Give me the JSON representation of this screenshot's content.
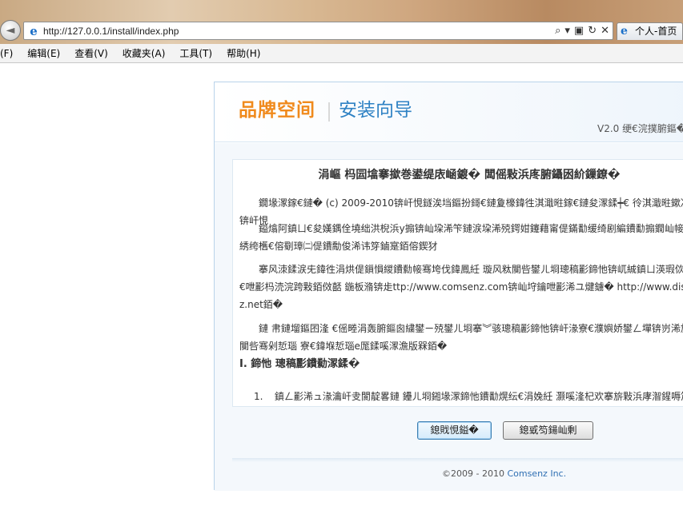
{
  "browser": {
    "url": "http://127.0.0.1/install/index.php",
    "tab_title": "个人-首页",
    "back_glyph": "◄",
    "address_tools": [
      "⌕",
      "▾",
      "▣",
      "↻",
      "✕"
    ]
  },
  "menu": {
    "items": [
      "(F)",
      "编辑(E)",
      "查看(V)",
      "收藏夹(A)",
      "工具(T)",
      "帮助(H)"
    ]
  },
  "installer": {
    "logo_brand": "品牌空间",
    "logo_title": "安装向导",
    "version": "V2.0 绠€浣撲腑鏂�",
    "license_title": "涓嶇 杩囩墖搴撳巻鍙缇庡崡鍍� 闆傜敤浜庝腑鑷囦紒鏁鐐�",
    "paragraphs": [
      "鐗堟潈鎵€鏈� (c) 2009-2010锛屽悓鐩涘垱鏂扮鎶€鏈夐檺鍏徃淇濈暀鎵€鏈夋潈鍒┿€ 彾淇濈暀鏉冮檺锛屽悓",
      "鎰熻阿鎮ㄩ€夋嫨鍝佺墝绌洪棿浜у搧锛屾垜浠笇鏈涙垜浠殑鍔姏鑳藉甯偍鏋勫缓绮剧編鐨勫搧鐗屾帹骞跨綉绔欍€傛劅璋㈡偍鐨勪俊浠讳笌鏀寔銆傛鍥犲",
      "搴风洓鍒涙兂鍏徃涓烘偍鎻愪緵鐨勬帹骞垮伐鍏鳳紝 璇风粏闃呰鐢ㄦ埛璁稿彲鍗忚锛屼絾鎮ㄩ渶瑕佽鍗忚€呭彲杩涜浣跨敤銆傚嚭 鍦板潃锛歨ttp://www.comsenz.com锛屾垨鑰呭彲浠ユ煡鐪� http://www.discuz.net銆�",
      "鏈 帇鏈塯鏂囨湰 €傜畻涓轰腑鏂囪繍鐢ㄧ殑鐢ㄦ埛搴︾骇璁稿彲鍗忚锛屽湪寮€濮嬩娇鐢ㄥ墠锛岃浠旂粏闃呰骞剁悊瑙 寮€鍏堢悊瑙e厖鍒嗘潈澹版槑銆�"
    ],
    "section_head": "I. 鍗忚 璁稿彲鐨勬潈鍒�",
    "list_items": [
      {
        "num": "1.",
        "text": "鎮ㄥ彲浠ュ湪瀹屽叏閬靛畧鏈 鑸ㄦ埛鎺堟潈鍗忚鐨勫熀纭€涓婏紝 灏嗘湰杞欢搴旂敤浜庨潪鍟嗕笟鐢ㄩ€旓紝鑰屼笉蹇呮敮浠樿蒋浠剁増"
      }
    ],
    "buttons": {
      "agree": "鎴戝悓鎰�",
      "disagree": "鎴戜笉鍚屾剰"
    },
    "footer": {
      "copyright": "©2009 - 2010 ",
      "company": "Comsenz Inc."
    }
  },
  "colors": {
    "brand_orange": "#f08a1c",
    "brand_blue": "#2f82c4",
    "panel_border": "#b9d3ea"
  }
}
